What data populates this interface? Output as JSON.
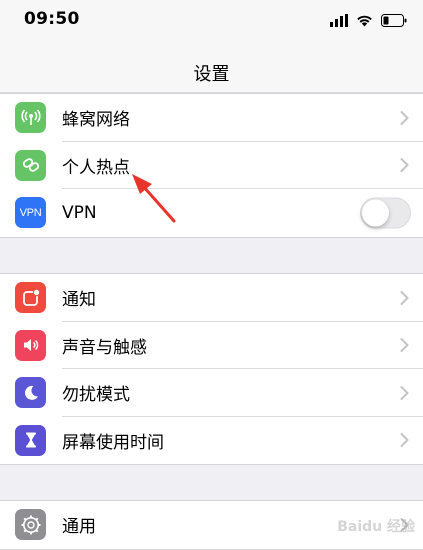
{
  "status": {
    "time": "09:50"
  },
  "nav": {
    "title": "设置"
  },
  "group1": {
    "items": [
      {
        "label": "蜂窝网络",
        "icon": "cellular-icon",
        "color": "#65c466"
      },
      {
        "label": "个人热点",
        "icon": "hotspot-icon",
        "color": "#65c466"
      },
      {
        "label": "VPN",
        "icon": "vpn-icon",
        "color": "#2f74f6",
        "icon_text": "VPN",
        "toggle": false
      }
    ]
  },
  "group2": {
    "items": [
      {
        "label": "通知",
        "icon": "notifications-icon",
        "color": "#f04a3e"
      },
      {
        "label": "声音与触感",
        "icon": "sounds-icon",
        "color": "#f0445c"
      },
      {
        "label": "勿扰模式",
        "icon": "do-not-disturb-icon",
        "color": "#5b56d6"
      },
      {
        "label": "屏幕使用时间",
        "icon": "screen-time-icon",
        "color": "#5b4fd3"
      }
    ]
  },
  "group3": {
    "items": [
      {
        "label": "通用",
        "icon": "gear-icon",
        "color": "#8e8e93"
      }
    ]
  },
  "watermark": {
    "text": "Baidu 经验"
  }
}
